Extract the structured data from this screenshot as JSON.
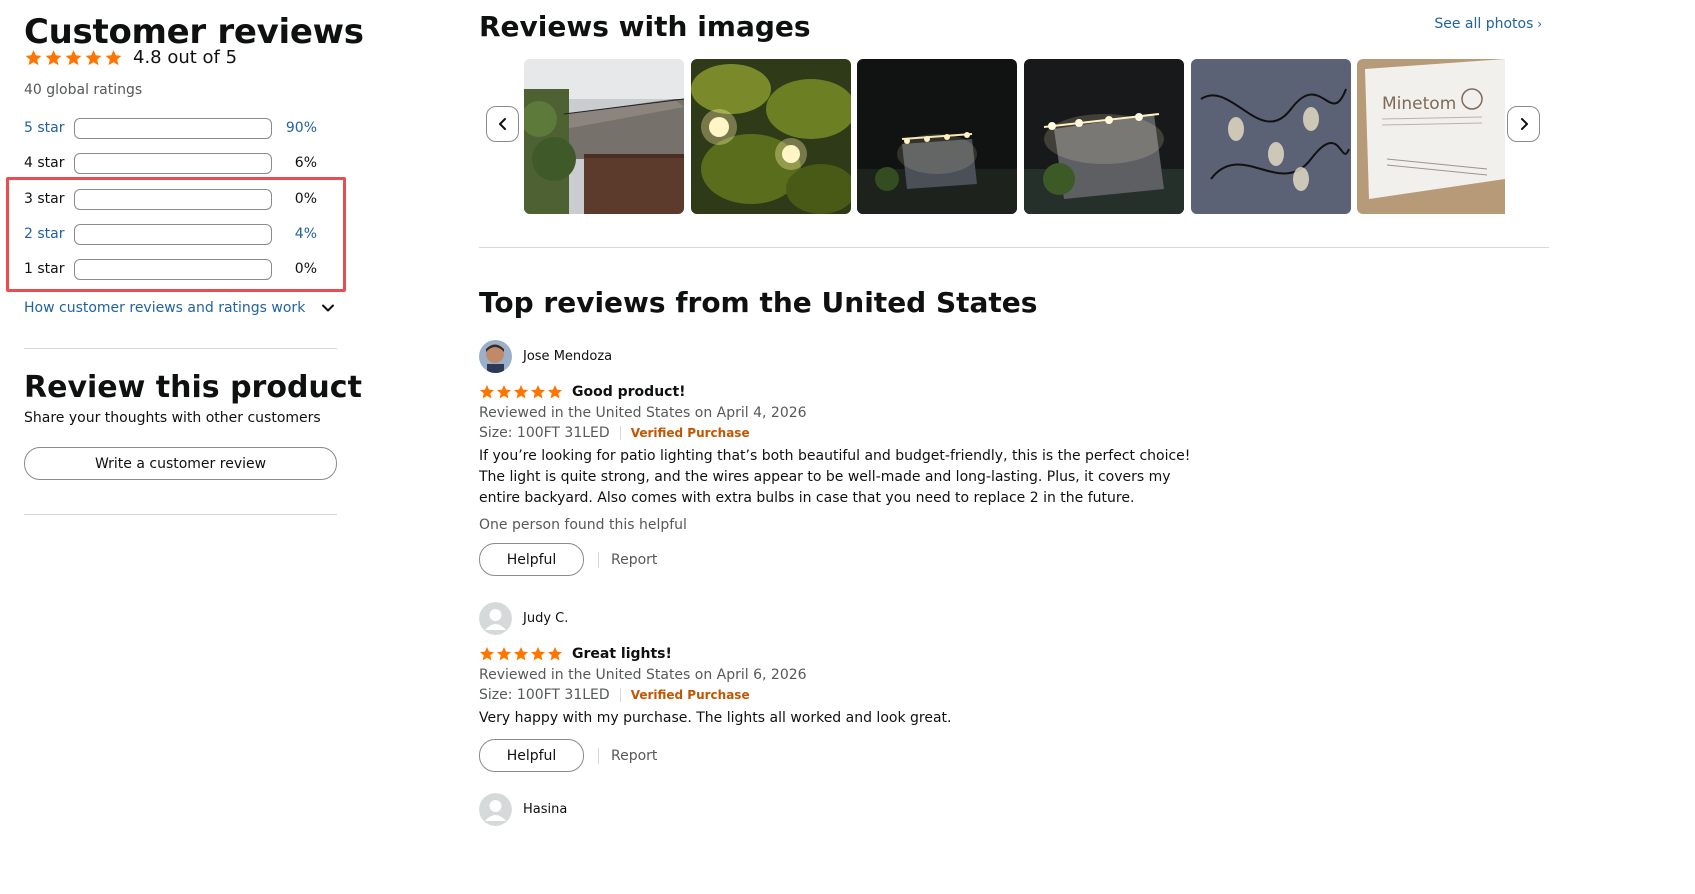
{
  "summary": {
    "title": "Customer reviews",
    "rating_text": "4.8 out of 5",
    "rating_value": 4.8,
    "global_ratings": "40 global ratings"
  },
  "histogram": [
    {
      "label": "5 star",
      "percent": "90%",
      "value": 90,
      "is_link": true
    },
    {
      "label": "4 star",
      "percent": "6%",
      "value": 6,
      "is_link": false
    },
    {
      "label": "3 star",
      "percent": "0%",
      "value": 0,
      "is_link": false
    },
    {
      "label": "2 star",
      "percent": "4%",
      "value": 4,
      "is_link": true
    },
    {
      "label": "1 star",
      "percent": "0%",
      "value": 0,
      "is_link": false
    }
  ],
  "how_link": "How customer reviews and ratings work",
  "review_product": {
    "title": "Review this product",
    "subtitle": "Share your thoughts with other customers",
    "button_label": "Write a customer review"
  },
  "images_section": {
    "title": "Reviews with images",
    "see_all": "See all photos"
  },
  "top_reviews_title": "Top reviews from the United States",
  "reviews": [
    {
      "name": "Jose Mendoza",
      "title": "Good product!",
      "meta": "Reviewed in the United States on April 4, 2026",
      "size": "Size: 100FT 31LED",
      "verified": "Verified Purchase",
      "body": "If you’re looking for patio lighting that’s both beautiful and budget-friendly, this is the perfect choice! The light is quite strong, and the wires appear to be well-made and long-lasting. Plus, it covers my entire backyard. Also comes with extra bulbs in case that you need to replace 2 in the future.",
      "helpful_count": "One person found this helpful",
      "helpful_label": "Helpful",
      "report_label": "Report"
    },
    {
      "name": "Judy C.",
      "title": "Great lights!",
      "meta": "Reviewed in the United States on April 6, 2026",
      "size": "Size: 100FT 31LED",
      "verified": "Verified Purchase",
      "body": "Very happy with my purchase. The lights all worked and look great.",
      "helpful_label": "Helpful",
      "report_label": "Report"
    },
    {
      "name": "Hasina"
    }
  ],
  "thumbnail_brand_text": "Minetom",
  "colors": {
    "star": "#ff7500",
    "link": "#2162a1",
    "verified": "#c45500",
    "highlight": "#ec4c4f"
  }
}
